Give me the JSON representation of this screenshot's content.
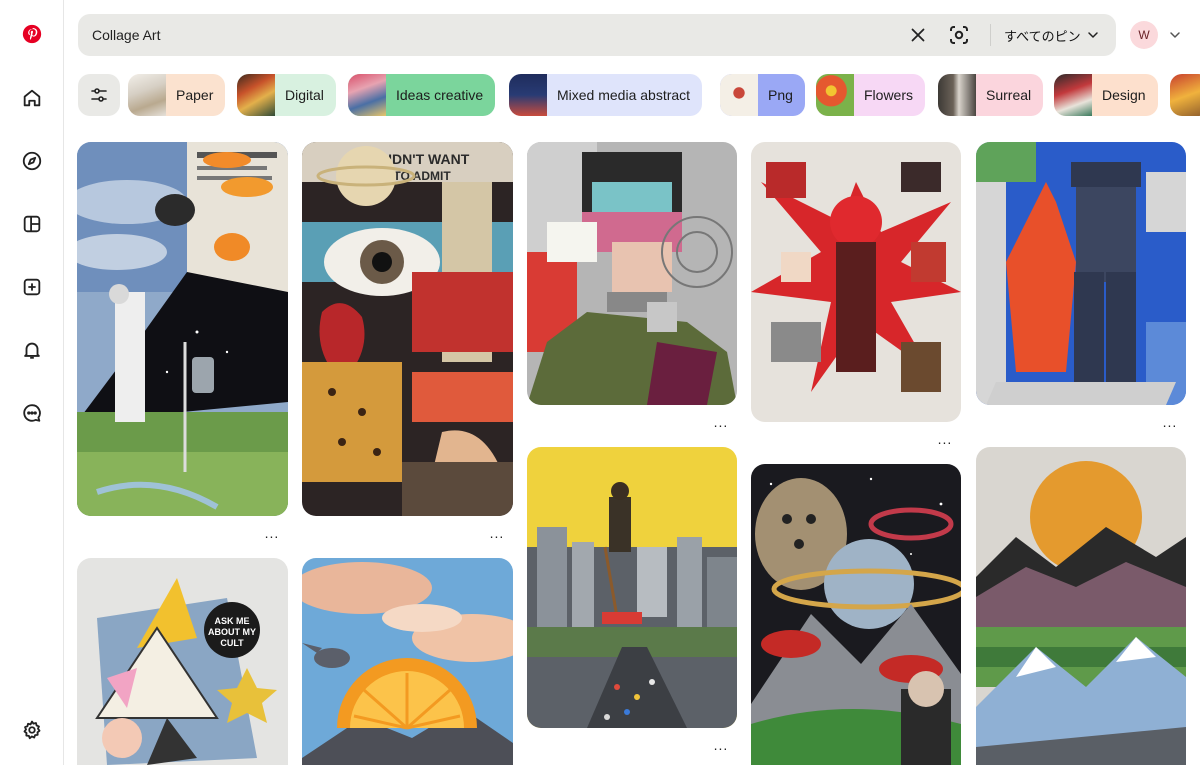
{
  "app": {
    "name": "Pinterest",
    "logo_color": "#e60023"
  },
  "sidebar": {
    "items": [
      {
        "icon": "pinterest-logo"
      },
      {
        "icon": "home-icon"
      },
      {
        "icon": "explore-compass-icon"
      },
      {
        "icon": "boards-icon"
      },
      {
        "icon": "create-plus-icon"
      },
      {
        "icon": "notifications-bell-icon"
      },
      {
        "icon": "messages-icon"
      },
      {
        "icon": "settings-gear-icon"
      }
    ]
  },
  "search": {
    "value": "Collage Art",
    "filter_label": "すべてのピン"
  },
  "user": {
    "initial": "W",
    "avatar_color": "#fbd9dc"
  },
  "chips": [
    {
      "label": "Paper",
      "color": "#fbe2cf"
    },
    {
      "label": "Digital",
      "color": "#d8f1e0"
    },
    {
      "label": "Ideas creative",
      "color": "#7bd59c"
    },
    {
      "label": "Mixed media abstract",
      "color": "#dfe4fb"
    },
    {
      "label": "Png",
      "color": "#9aa8f5"
    },
    {
      "label": "Flowers",
      "color": "#f7d8f5"
    },
    {
      "label": "Surreal",
      "color": "#fbd5dd"
    },
    {
      "label": "Design",
      "color": "#fde0cd"
    }
  ],
  "pins": {
    "more_label": "..."
  }
}
